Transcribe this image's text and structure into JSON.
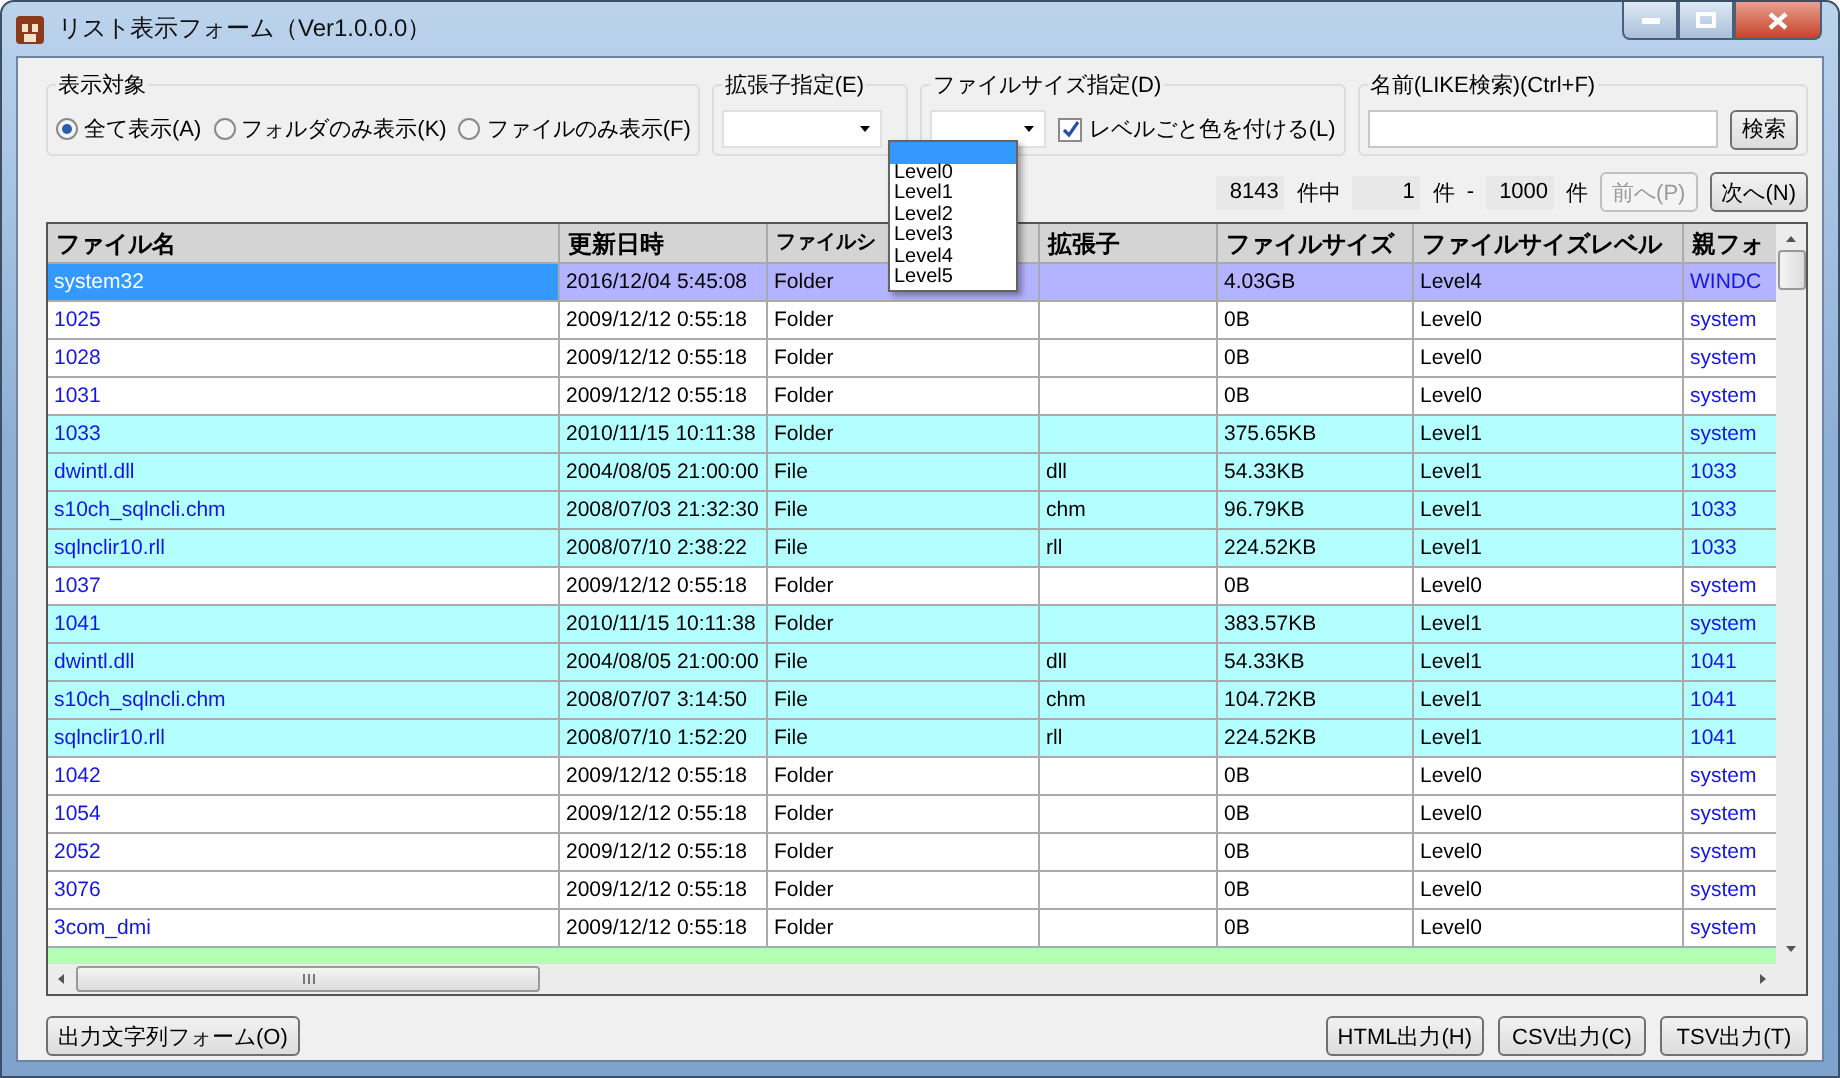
{
  "window": {
    "title": "リスト表示フォーム（Ver1.0.0.0）"
  },
  "display_target": {
    "label": "表示対象",
    "options": [
      {
        "label": "全て表示(A)",
        "selected": true
      },
      {
        "label": "フォルダのみ表示(K)",
        "selected": false
      },
      {
        "label": "ファイルのみ表示(F)",
        "selected": false
      }
    ]
  },
  "extension_filter": {
    "label": "拡張子指定(E)"
  },
  "size_filter": {
    "label": "ファイルサイズ指定(D)",
    "color_by_level": {
      "label": "レベルごと色を付ける(L)",
      "checked": true
    },
    "dropdown": {
      "blank_entry_selected": true,
      "items": [
        {
          "label": "Level0",
          "selected": false
        },
        {
          "label": "Level1",
          "selected": false
        },
        {
          "label": "Level2",
          "selected": false
        },
        {
          "label": "Level3",
          "selected": false
        },
        {
          "label": "Level4",
          "selected": false
        },
        {
          "label": "Level5",
          "selected": false
        }
      ]
    }
  },
  "name_search": {
    "label": "名前(LIKE検索)(Ctrl+F)",
    "button": "検索"
  },
  "pager": {
    "total": "8143",
    "total_suffix": "件中",
    "from": "1",
    "from_suffix": "件",
    "dash": "-",
    "to": "1000",
    "to_suffix": "件",
    "prev": {
      "label": "前へ(P)",
      "disabled": true
    },
    "next": {
      "label": "次へ(N)",
      "disabled": false
    }
  },
  "table": {
    "columns": [
      "ファイル名",
      "更新日時",
      "ファイルシ",
      "拡張子",
      "ファイルサイズ",
      "ファイルサイズレベル",
      "親フォ"
    ],
    "rows": [
      {
        "cells": [
          "system32",
          "2016/12/04 5:45:08",
          "Folder",
          "",
          "4.03GB",
          "Level4",
          "WINDC"
        ],
        "color": "#b3b3ff",
        "selected": true
      },
      {
        "cells": [
          "1025",
          "2009/12/12 0:55:18",
          "Folder",
          "",
          "0B",
          "Level0",
          "system"
        ],
        "color": "#ffffff",
        "selected": false
      },
      {
        "cells": [
          "1028",
          "2009/12/12 0:55:18",
          "Folder",
          "",
          "0B",
          "Level0",
          "system"
        ],
        "color": "#ffffff",
        "selected": false
      },
      {
        "cells": [
          "1031",
          "2009/12/12 0:55:18",
          "Folder",
          "",
          "0B",
          "Level0",
          "system"
        ],
        "color": "#ffffff",
        "selected": false
      },
      {
        "cells": [
          "1033",
          "2010/11/15 10:11:38",
          "Folder",
          "",
          "375.65KB",
          "Level1",
          "system"
        ],
        "color": "#b3ffff",
        "selected": false
      },
      {
        "cells": [
          "dwintl.dll",
          "2004/08/05 21:00:00",
          "File",
          "dll",
          "54.33KB",
          "Level1",
          "1033"
        ],
        "color": "#b3ffff",
        "selected": false
      },
      {
        "cells": [
          "s10ch_sqlncli.chm",
          "2008/07/03 21:32:30",
          "File",
          "chm",
          "96.79KB",
          "Level1",
          "1033"
        ],
        "color": "#b3ffff",
        "selected": false
      },
      {
        "cells": [
          "sqlnclir10.rll",
          "2008/07/10 2:38:22",
          "File",
          "rll",
          "224.52KB",
          "Level1",
          "1033"
        ],
        "color": "#b3ffff",
        "selected": false
      },
      {
        "cells": [
          "1037",
          "2009/12/12 0:55:18",
          "Folder",
          "",
          "0B",
          "Level0",
          "system"
        ],
        "color": "#ffffff",
        "selected": false
      },
      {
        "cells": [
          "1041",
          "2010/11/15 10:11:38",
          "Folder",
          "",
          "383.57KB",
          "Level1",
          "system"
        ],
        "color": "#b3ffff",
        "selected": false
      },
      {
        "cells": [
          "dwintl.dll",
          "2004/08/05 21:00:00",
          "File",
          "dll",
          "54.33KB",
          "Level1",
          "1041"
        ],
        "color": "#b3ffff",
        "selected": false
      },
      {
        "cells": [
          "s10ch_sqlncli.chm",
          "2008/07/07 3:14:50",
          "File",
          "chm",
          "104.72KB",
          "Level1",
          "1041"
        ],
        "color": "#b3ffff",
        "selected": false
      },
      {
        "cells": [
          "sqlnclir10.rll",
          "2008/07/10 1:52:20",
          "File",
          "rll",
          "224.52KB",
          "Level1",
          "1041"
        ],
        "color": "#b3ffff",
        "selected": false
      },
      {
        "cells": [
          "1042",
          "2009/12/12 0:55:18",
          "Folder",
          "",
          "0B",
          "Level0",
          "system"
        ],
        "color": "#ffffff",
        "selected": false
      },
      {
        "cells": [
          "1054",
          "2009/12/12 0:55:18",
          "Folder",
          "",
          "0B",
          "Level0",
          "system"
        ],
        "color": "#ffffff",
        "selected": false
      },
      {
        "cells": [
          "2052",
          "2009/12/12 0:55:18",
          "Folder",
          "",
          "0B",
          "Level0",
          "system"
        ],
        "color": "#ffffff",
        "selected": false
      },
      {
        "cells": [
          "3076",
          "2009/12/12 0:55:18",
          "Folder",
          "",
          "0B",
          "Level0",
          "system"
        ],
        "color": "#ffffff",
        "selected": false
      },
      {
        "cells": [
          "3com_dmi",
          "2009/12/12 0:55:18",
          "Folder",
          "",
          "0B",
          "Level0",
          "system"
        ],
        "color": "#ffffff",
        "selected": false
      }
    ],
    "partial_row": {
      "color": "#b3ffb3"
    }
  },
  "footer": {
    "left_button": "出力文字列フォーム(O)",
    "buttons": [
      "HTML出力(H)",
      "CSV出力(C)",
      "TSV出力(T)"
    ]
  }
}
